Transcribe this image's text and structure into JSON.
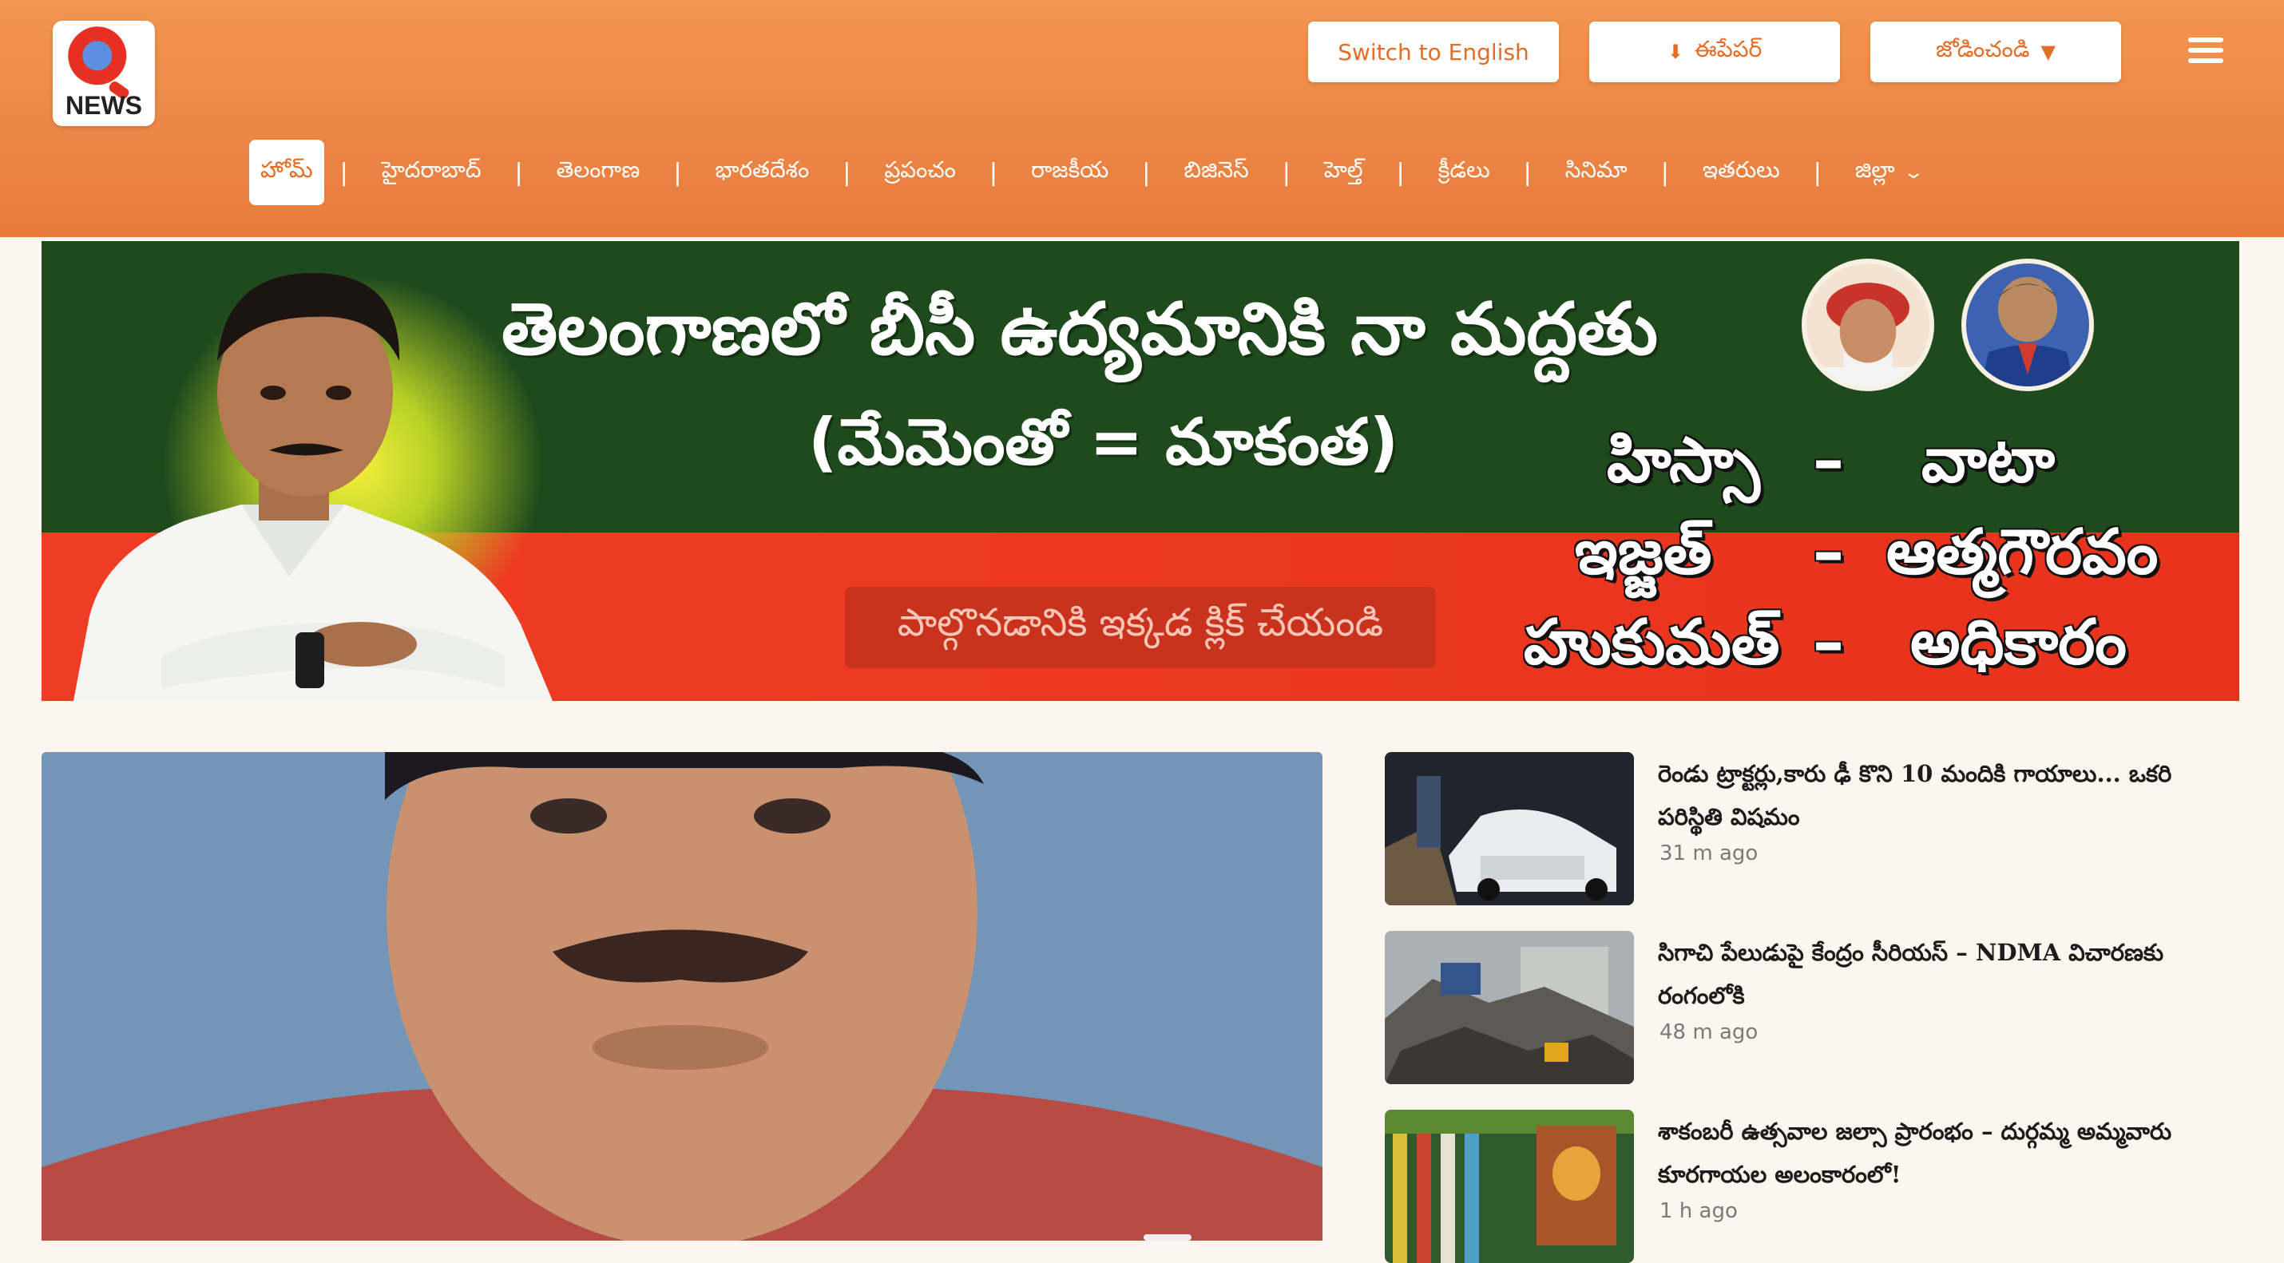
{
  "header": {
    "logo_text": "NEWS",
    "switch_language": "Switch to English",
    "epaper": "ఈపేపర్",
    "join": "జోడించండి"
  },
  "nav": {
    "items": [
      "హోమ్",
      "హైదరాబాద్",
      "తెలంగాణ",
      "భారతదేశం",
      "ప్రపంచం",
      "రాజకీయ",
      "బిజినెస్",
      "హెల్త్",
      "క్రీడలు",
      "సినిమా",
      "ఇతరులు",
      "జిల్లా"
    ]
  },
  "banner": {
    "headline": "తెలంగాణలో బీసీ ఉద్యమానికి నా మద్దతు",
    "subheadline": "(మేమెంతో = మాకంత)",
    "cta": "పాల్గొనడానికి ఇక్కడ క్లిక్ చేయండి",
    "slogans": [
      {
        "left": "హిస్సా",
        "dash": "–",
        "right": "వాటా"
      },
      {
        "left": "ఇజ్జత్",
        "dash": "–",
        "right": "ఆత్మగౌరవం"
      },
      {
        "left": "హుకుమత్",
        "dash": "–",
        "right": "అధికారం"
      }
    ]
  },
  "news": [
    {
      "title": "రెండు ట్రాక్టర్లు,కారు ఢీ కొని 10 మందికి గాయాలు... ఒకరి పరిస్థితి విషమం",
      "time": "31 m ago"
    },
    {
      "title": "సిగాచి పేలుడుపై కేంద్రం సీరియస్ – NDMA విచారణకు రంగంలోకి",
      "time": "48 m ago"
    },
    {
      "title": "శాకంబరీ ఉత్సవాల జల్సా ప్రారంభం – దుర్గమ్మ అమ్మవారు కూరగాయల అలంకారంలో!",
      "time": "1 h ago"
    }
  ],
  "colors": {
    "header_orange": "#ec8746",
    "accent": "#e46c25",
    "banner_green": "#1f4a1d",
    "banner_red": "#ef3d24"
  }
}
